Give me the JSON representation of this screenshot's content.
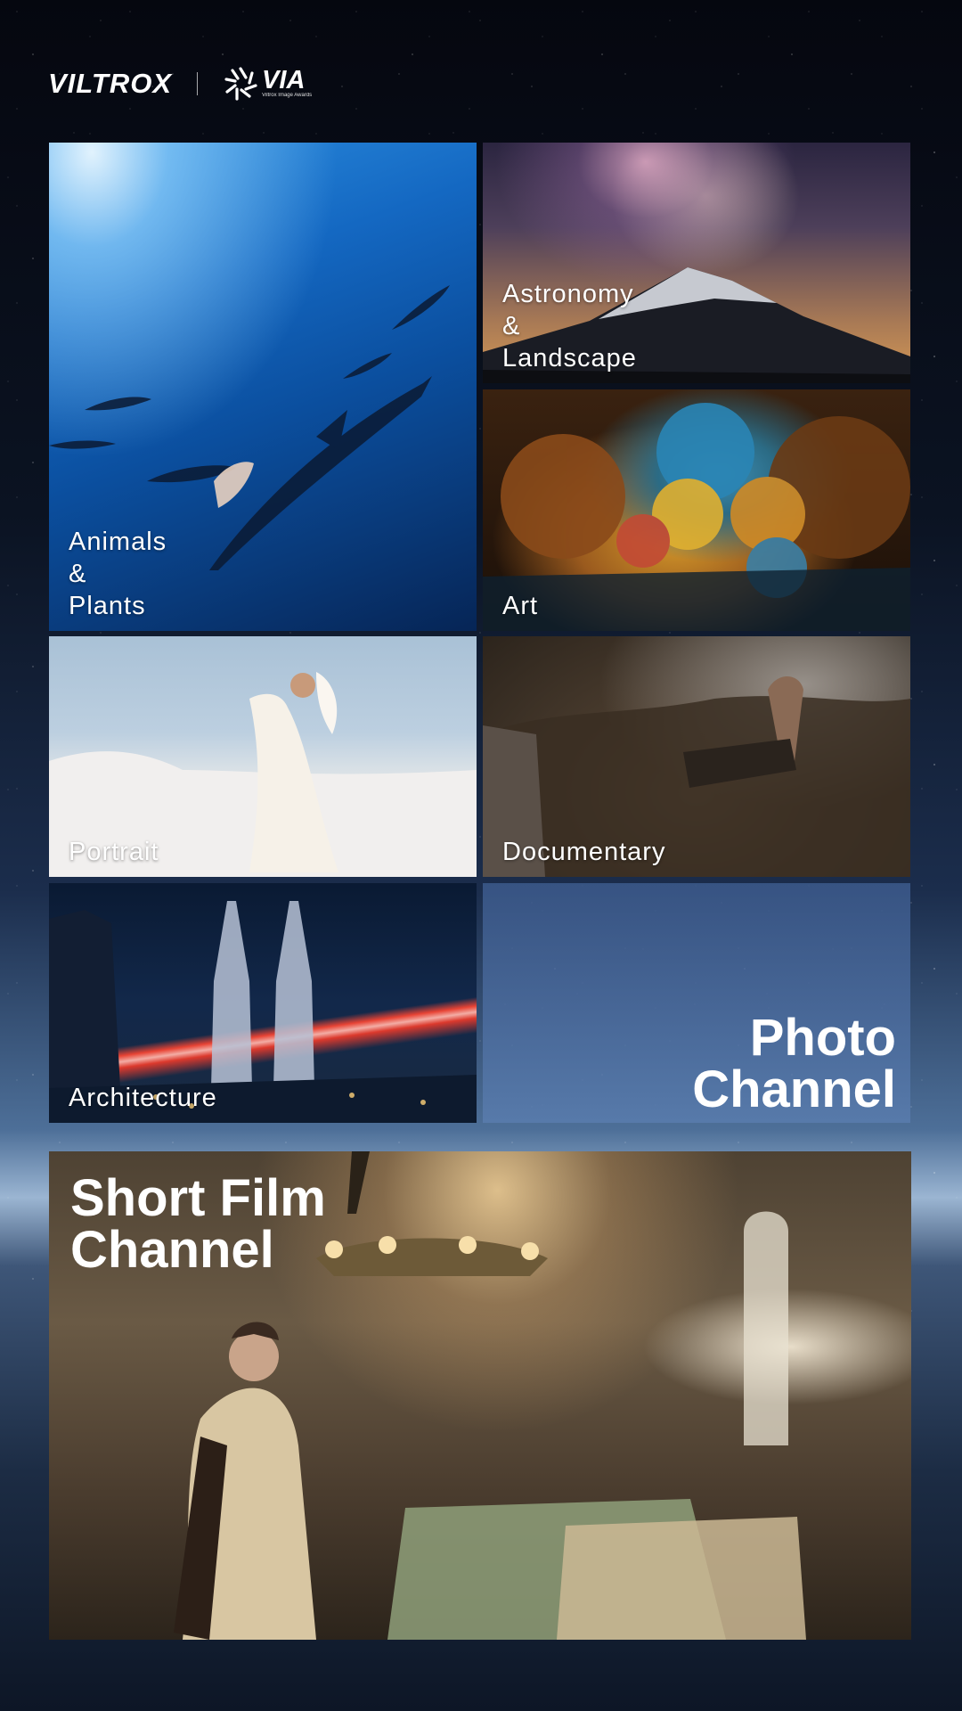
{
  "header": {
    "brand": "VILTROX",
    "via_logo": "VIA",
    "via_subtitle": "Viltrox Image Awards"
  },
  "photo_tiles": [
    {
      "label": "Animals\n&\nPlants"
    },
    {
      "label": "Astronomy\n&\nLandscape"
    },
    {
      "label": "Art"
    },
    {
      "label": "Portrait"
    },
    {
      "label": "Documentary"
    },
    {
      "label": "Architecture"
    }
  ],
  "photo_channel": {
    "title": "Photo\nChannel"
  },
  "film_channel": {
    "title": "Short Film\nChannel"
  },
  "icons": [
    "via-aperture-icon"
  ],
  "colors": {
    "background_top": "#05070f",
    "horizon": "#9bb5d2",
    "text": "#ffffff"
  }
}
